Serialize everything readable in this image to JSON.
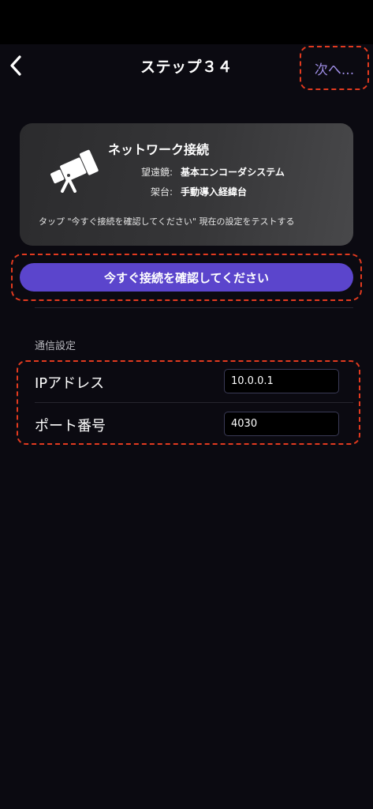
{
  "nav": {
    "title": "ステップ３４",
    "next_label": "次へ..."
  },
  "card": {
    "title": "ネットワーク接続",
    "telescope_label": "望遠鏡:",
    "telescope_value": "基本エンコーダシステム",
    "mount_label": "架台:",
    "mount_value": "手動導入経緯台",
    "hint": "タップ \"今すぐ接続を確認してください\" 現在の設定をテストする"
  },
  "verify_button_label": "今すぐ接続を確認してください",
  "settings": {
    "section_title": "通信設定",
    "ip_label": "IPアドレス",
    "ip_value": "10.0.0.1",
    "port_label": "ポート番号",
    "port_value": "4030"
  },
  "colors": {
    "accent": "#5b45cc",
    "next_text": "#9d8ce3",
    "highlight": "#e23a1f",
    "background": "#0b0a11"
  },
  "icons": {
    "back": "chevron-left-icon",
    "telescope": "telescope-icon"
  }
}
